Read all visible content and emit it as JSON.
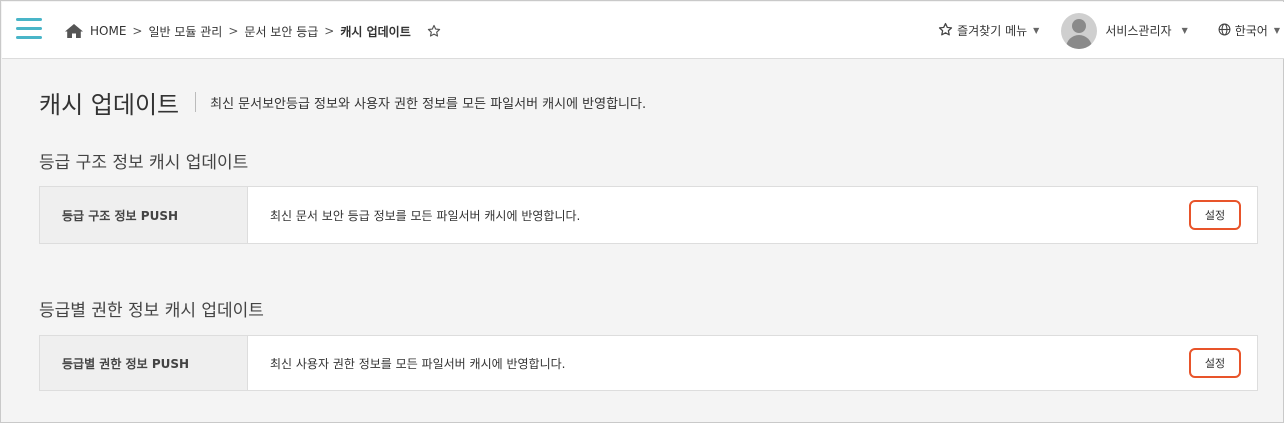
{
  "topbar": {
    "breadcrumb": [
      "HOME",
      "일반 모듈 관리",
      "문서 보안 등급",
      "캐시 업데이트"
    ],
    "favorites_label": "즐겨찾기 메뉴",
    "user_name": "서비스관리자",
    "language": "한국어"
  },
  "page": {
    "title": "캐시 업데이트",
    "description": "최신 문서보안등급 정보와 사용자 권한 정보를 모든 파일서버 캐시에 반영합니다."
  },
  "sections": [
    {
      "title": "등급 구조 정보 캐시 업데이트",
      "label": "등급 구조 정보 PUSH",
      "description": "최신 문서 보안 등급 정보를 모든 파일서버 캐시에 반영합니다.",
      "button": "설정"
    },
    {
      "title": "등급별 권한 정보 캐시 업데이트",
      "label": "등급별 권한 정보 PUSH",
      "description": "최신 사용자 권한 정보를 모든 파일서버 캐시에 반영합니다.",
      "button": "설정"
    }
  ],
  "colors": {
    "accent": "#49b5c8",
    "button_highlight": "#e8542a"
  }
}
